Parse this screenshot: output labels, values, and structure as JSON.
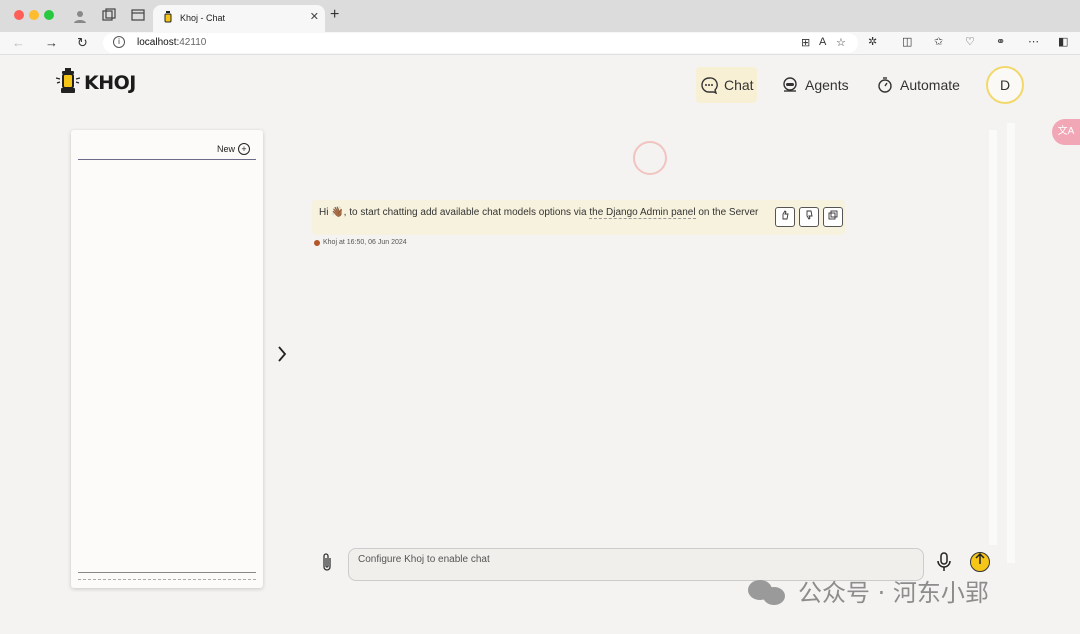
{
  "browser": {
    "tab_title": "Khoj - Chat",
    "tab_close": "✕",
    "new_tab": "+",
    "url_host": "localhost:",
    "url_port": "42110"
  },
  "header": {
    "logo_text": "KHOJ",
    "nav": {
      "chat": "Chat",
      "agents": "Agents",
      "automate": "Automate"
    },
    "avatar_letter": "D"
  },
  "sidebar": {
    "new_label": "New"
  },
  "conversation": {
    "message": {
      "prefix": "Hi 👋🏾, to start chatting add available chat models options via ",
      "link_text": "the Django Admin panel",
      "suffix": " on the Server"
    },
    "meta": "Khoj at 16:50, 06 Jun 2024"
  },
  "input": {
    "placeholder": "Configure Khoj to enable chat"
  },
  "watermark": {
    "text": "公众号 · 河东小郢"
  },
  "colors": {
    "accent": "#f5c518",
    "chat_nav_bg": "#f8f0d4",
    "message_bg": "#f7f2dd",
    "page_bg": "#f4f3f1"
  }
}
